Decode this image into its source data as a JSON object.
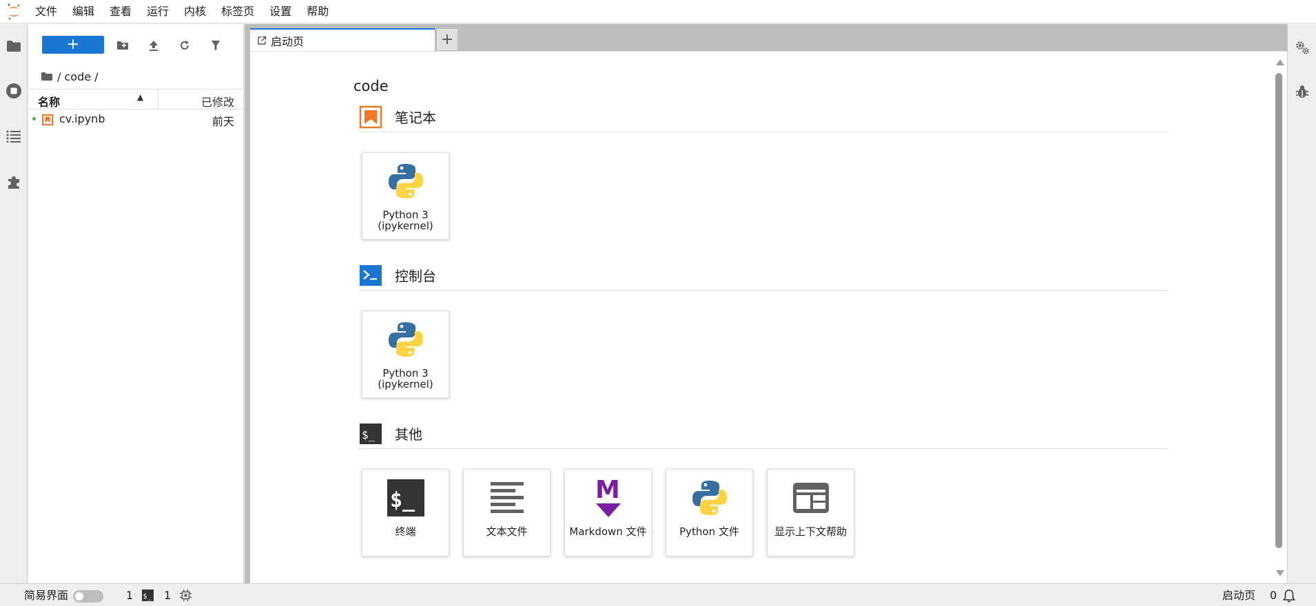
{
  "menubar": {
    "items": [
      "文件",
      "编辑",
      "查看",
      "运行",
      "内核",
      "标签页",
      "设置",
      "帮助"
    ]
  },
  "filebrowser": {
    "new_button_label": "+",
    "breadcrumb": "/ code /",
    "columns": {
      "name": "名称",
      "modified": "已修改"
    },
    "files": [
      {
        "name": "cv.ipynb",
        "modified": "前天",
        "running": true
      }
    ]
  },
  "tabs": {
    "active_label": "启动页",
    "add_label": "+"
  },
  "launcher": {
    "title": "code",
    "sections": [
      {
        "label": "笔记本",
        "icon": "notebook-icon",
        "cards": [
          {
            "label_line1": "Python 3",
            "label_line2": "(ipykernel)",
            "icon": "python-logo"
          }
        ]
      },
      {
        "label": "控制台",
        "icon": "console-icon",
        "cards": [
          {
            "label_line1": "Python 3",
            "label_line2": "(ipykernel)",
            "icon": "python-logo"
          }
        ]
      },
      {
        "label": "其他",
        "icon": "terminal-section-icon",
        "cards": [
          {
            "label": "终端",
            "icon": "terminal-icon"
          },
          {
            "label": "文本文件",
            "icon": "text-file-icon"
          },
          {
            "label": "Markdown 文件",
            "icon": "markdown-icon"
          },
          {
            "label": "Python 文件",
            "icon": "python-logo"
          },
          {
            "label": "显示上下文帮助",
            "icon": "contextual-help-icon"
          }
        ]
      }
    ]
  },
  "statusbar": {
    "simple_mode_label": "简易界面",
    "simple_mode_on": false,
    "kernels_count": "1",
    "terminals_count": "1",
    "current_tab": "启动页",
    "notifications_count": "0"
  },
  "colors": {
    "accent": "#1976d2",
    "jupyter_orange": "#f37726",
    "markdown_purple": "#7b1fa2",
    "python_blue": "#366fa1",
    "python_yellow": "#ffd343"
  }
}
